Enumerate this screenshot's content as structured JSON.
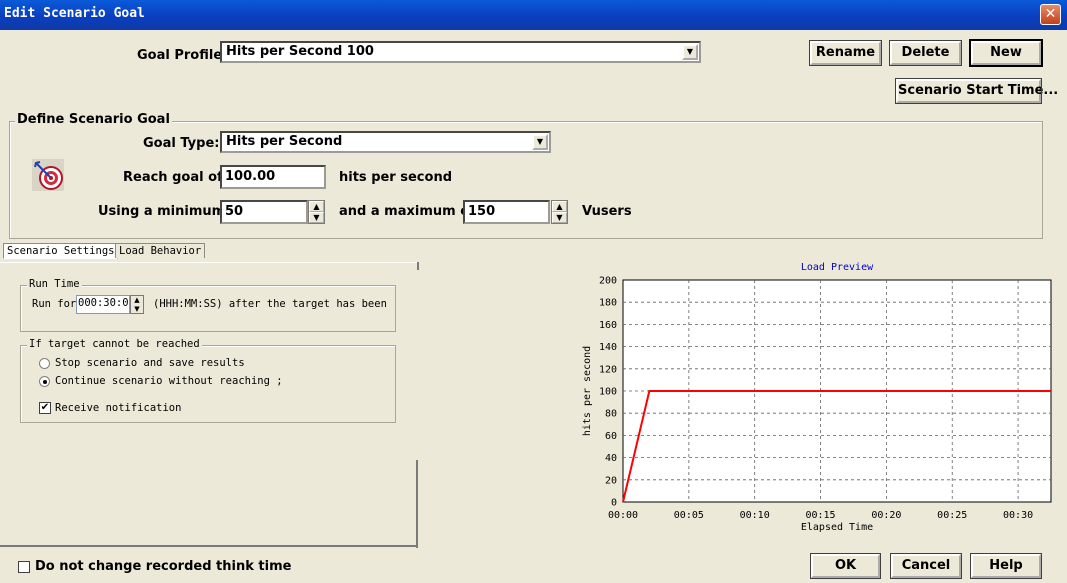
{
  "window": {
    "title": "Edit Scenario Goal",
    "close_glyph": "✕"
  },
  "goal_profile": {
    "label": "Goal Profile",
    "value": "Hits per Second 100"
  },
  "buttons": {
    "rename": "Rename",
    "delete": "Delete",
    "new": "New",
    "scenario_start_time": "Scenario Start Time...",
    "ok": "OK",
    "cancel": "Cancel",
    "help": "Help"
  },
  "define_goal": {
    "title": "Define Scenario Goal",
    "goal_type_label": "Goal Type:",
    "goal_type_value": "Hits per Second",
    "reach_goal_label": "Reach goal of",
    "reach_goal_value": "100.00",
    "reach_goal_unit": "hits per second",
    "min_label": "Using a minimum",
    "min_value": "50",
    "max_label": "and a maximum of",
    "max_value": "150",
    "vusers_label": "Vusers",
    "icon": "target-icon"
  },
  "tabs": [
    {
      "label": "Scenario Settings",
      "active": true
    },
    {
      "label": "Load Behavior",
      "active": false
    }
  ],
  "run_time": {
    "title": "Run Time",
    "run_for_label": "Run for",
    "run_for_value": "000:30:0",
    "format_text": "(HHH:MM:SS) after the target has been"
  },
  "target_unreached": {
    "title": "If target cannot be reached",
    "option_stop": "Stop scenario and save results",
    "option_continue": "Continue scenario without reaching ;",
    "selected": "continue",
    "notify_label": "Receive notification",
    "notify_checked": true
  },
  "think_time": {
    "label": "Do not change recorded think time",
    "checked": false
  },
  "chart_data": {
    "type": "line",
    "title": "Load Preview",
    "xlabel": "Elapsed Time",
    "ylabel": "hits per second",
    "xlim": [
      0,
      32.5
    ],
    "ylim": [
      0,
      200
    ],
    "x_ticks": [
      "00:00",
      "00:05",
      "00:10",
      "00:15",
      "00:20",
      "00:25",
      "00:30"
    ],
    "y_ticks": [
      0,
      20,
      40,
      60,
      80,
      100,
      120,
      140,
      160,
      180,
      200
    ],
    "grid": true,
    "series": [
      {
        "x": [
          0,
          2,
          32.5
        ],
        "y": [
          0,
          100,
          100
        ],
        "color": "#ff0000"
      }
    ]
  }
}
